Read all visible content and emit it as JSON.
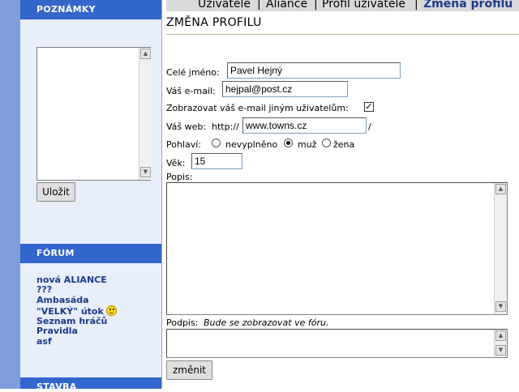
{
  "sidebar": {
    "notes": {
      "title": "POZNÁMKY",
      "save_label": "Uložit"
    },
    "forum": {
      "title": "FÓRUM",
      "links": [
        "nová ALIANCE",
        "???",
        "Ambasáda",
        "\"VELKÝ\" útok",
        "Seznam hráčů",
        "Pravidla",
        "asf"
      ]
    },
    "build": {
      "title": "STAVBA"
    }
  },
  "nav": {
    "items": [
      "Uživatelé",
      "|",
      "Aliance",
      "|",
      "Profil uživatele",
      "|",
      "Změna profilu"
    ]
  },
  "page": {
    "title": "ZMĚNA PROFILU"
  },
  "form": {
    "full_name_label": "Celé jméno:",
    "full_name_value": "Pavel Hejný",
    "email_label": "Váš e-mail:",
    "email_value": "hejpal@post.cz",
    "show_email_label": "Zobrazovat váš e-mail jiným uživatelům:",
    "show_email_checked": true,
    "web_label": "Váš web:",
    "web_prefix": "http://",
    "web_value": "www.towns.cz",
    "web_suffix": "/",
    "gender_label": "Pohlaví:",
    "gender_options": [
      "nevyplněno",
      "muž",
      "žena"
    ],
    "gender_selected": "muž",
    "age_label": "Věk:",
    "age_value": "15",
    "description_label": "Popis:",
    "description_value": "",
    "signature_label": "Podpis:",
    "signature_hint": "Bude se zobrazovat ve fóru.",
    "signature_value": "",
    "submit_label": "změnit"
  },
  "colors": {
    "sidebar_header": "#3366cc",
    "sidebar_bg": "#e8eefa",
    "left_strip": "#7f9fdb",
    "link": "#1a3a8c"
  }
}
